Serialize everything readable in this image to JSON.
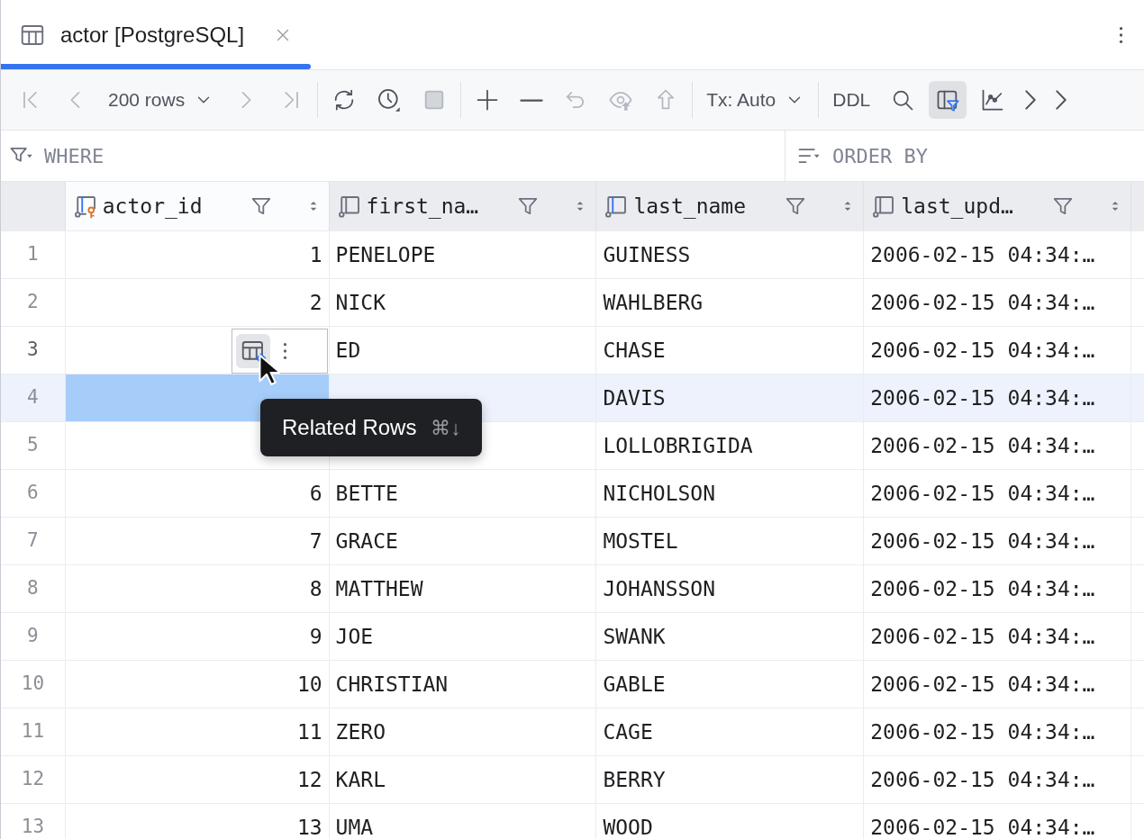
{
  "tab": {
    "title": "actor [PostgreSQL]",
    "selected": true
  },
  "toolbar": {
    "groups": [
      [
        {
          "kind": "first",
          "disabled": true,
          "on": false
        },
        {
          "kind": "previous",
          "disabled": true,
          "on": false
        },
        {
          "kind": "page_size",
          "label": "200 rows",
          "disabled": false,
          "on": false
        },
        {
          "kind": "next",
          "disabled": true,
          "on": false
        },
        {
          "kind": "last",
          "disabled": true,
          "on": false
        }
      ],
      [
        {
          "kind": "refresh",
          "disabled": false,
          "on": false
        },
        {
          "kind": "history",
          "disabled": false,
          "on": false
        },
        {
          "kind": "stop",
          "disabled": true,
          "on": false
        }
      ],
      [
        {
          "kind": "add",
          "disabled": false,
          "on": false
        },
        {
          "kind": "delete",
          "disabled": false,
          "on": false
        },
        {
          "kind": "revert",
          "disabled": true,
          "on": false
        },
        {
          "kind": "preview",
          "disabled": true,
          "on": false
        },
        {
          "kind": "submit",
          "disabled": true,
          "on": false
        }
      ],
      [
        {
          "kind": "transaction",
          "label": "Tx: Auto",
          "disabled": false,
          "on": false
        }
      ],
      [
        {
          "kind": "ddl",
          "label": "DDL",
          "disabled": false,
          "on": false
        },
        {
          "kind": "search",
          "disabled": false,
          "on": false
        },
        {
          "kind": "filter_panel",
          "disabled": false,
          "on": true
        },
        {
          "kind": "chart",
          "disabled": false,
          "on": false
        },
        {
          "kind": "more",
          "disabled": false,
          "on": false
        },
        {
          "kind": "more",
          "disabled": false,
          "on": false
        }
      ]
    ]
  },
  "filter": {
    "where": {
      "placeholder": "WHERE"
    },
    "order_by": {
      "placeholder": "ORDER BY"
    }
  },
  "columns": [
    {
      "name": "actor_id",
      "kind": "primary_key",
      "selected": true
    },
    {
      "name": "first_na…",
      "kind": "plain",
      "selected": false
    },
    {
      "name": "last_name",
      "kind": "indexed",
      "selected": false
    },
    {
      "name": "last_upd…",
      "kind": "plain",
      "selected": false
    }
  ],
  "rows": [
    {
      "number": "1",
      "cells": [
        "1",
        "PENELOPE",
        "GUINESS",
        "2006-02-15 04:34:…"
      ],
      "selected": false,
      "hovered": false
    },
    {
      "number": "2",
      "cells": [
        "2",
        "NICK",
        "WAHLBERG",
        "2006-02-15 04:34:…"
      ],
      "selected": false,
      "hovered": false
    },
    {
      "number": "3",
      "cells": [
        null,
        "ED",
        "CHASE",
        "2006-02-15 04:34:…"
      ],
      "selected": false,
      "hovered": true
    },
    {
      "number": "4",
      "cells": [
        null,
        null,
        "DAVIS",
        "2006-02-15 04:34:…"
      ],
      "selected": true,
      "hovered": false
    },
    {
      "number": "5",
      "cells": [
        null,
        null,
        "LOLLOBRIGIDA",
        "2006-02-15 04:34:…"
      ],
      "selected": false,
      "hovered": false
    },
    {
      "number": "6",
      "cells": [
        "6",
        "BETTE",
        "NICHOLSON",
        "2006-02-15 04:34:…"
      ],
      "selected": false,
      "hovered": false
    },
    {
      "number": "7",
      "cells": [
        "7",
        "GRACE",
        "MOSTEL",
        "2006-02-15 04:34:…"
      ],
      "selected": false,
      "hovered": false
    },
    {
      "number": "8",
      "cells": [
        "8",
        "MATTHEW",
        "JOHANSSON",
        "2006-02-15 04:34:…"
      ],
      "selected": false,
      "hovered": false
    },
    {
      "number": "9",
      "cells": [
        "9",
        "JOE",
        "SWANK",
        "2006-02-15 04:34:…"
      ],
      "selected": false,
      "hovered": false
    },
    {
      "number": "10",
      "cells": [
        "10",
        "CHRISTIAN",
        "GABLE",
        "2006-02-15 04:34:…"
      ],
      "selected": false,
      "hovered": false
    },
    {
      "number": "11",
      "cells": [
        "11",
        "ZERO",
        "CAGE",
        "2006-02-15 04:34:…"
      ],
      "selected": false,
      "hovered": false
    },
    {
      "number": "12",
      "cells": [
        "12",
        "KARL",
        "BERRY",
        "2006-02-15 04:34:…"
      ],
      "selected": false,
      "hovered": false
    },
    {
      "number": "13",
      "cells": [
        "13",
        "UMA",
        "WOOD",
        "2006-02-15 04:34:…"
      ],
      "selected": false,
      "hovered": false
    }
  ],
  "tooltip": {
    "label": "Related Rows",
    "shortcut": "⌘↓"
  }
}
